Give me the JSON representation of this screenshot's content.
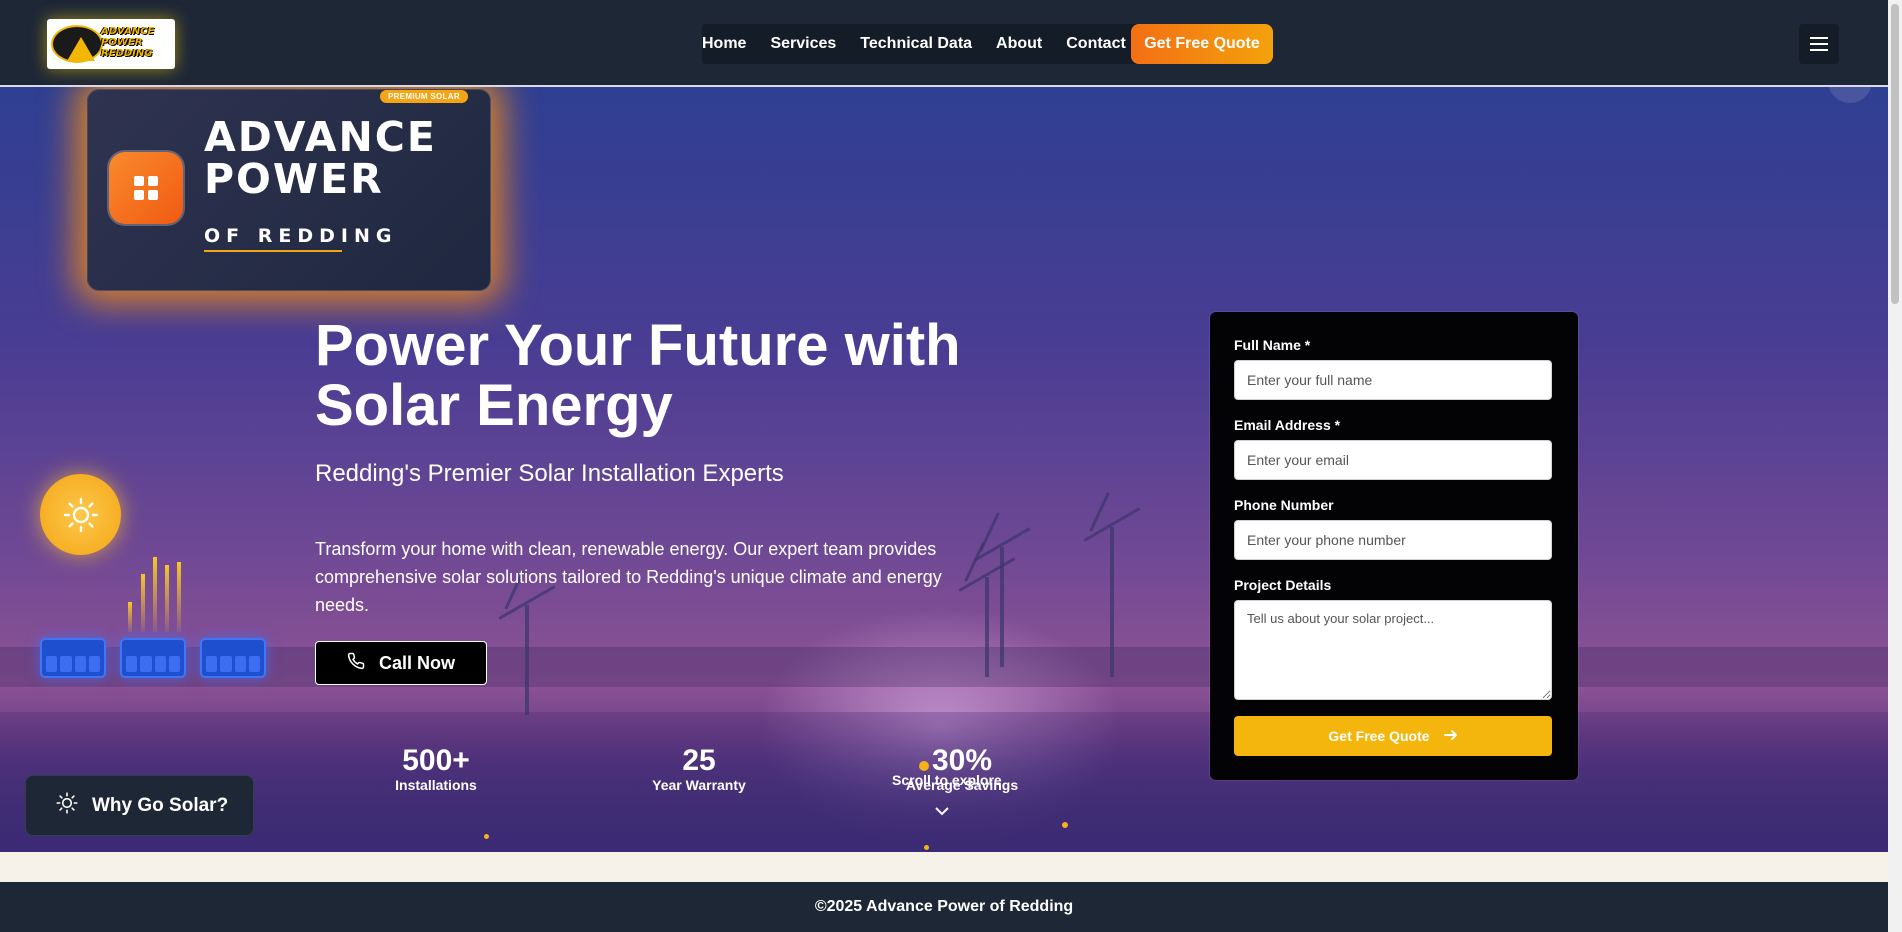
{
  "logo": {
    "text": "ADVANCE POWER REDDING"
  },
  "nav": {
    "links": [
      "Home",
      "Services",
      "Technical Data",
      "About",
      "Contact"
    ],
    "cta": "Get Free Quote"
  },
  "brand_card": {
    "badge": "PREMIUM SOLAR",
    "title_line1": "ADVANCE",
    "title_line2": "POWER",
    "subtitle": "OF REDDING"
  },
  "hero": {
    "title": "Power Your Future with Solar Energy",
    "subtitle": "Redding's Premier Solar Installation Experts",
    "description": "Transform your home with clean, renewable energy. Our expert team provides comprehensive solar solutions tailored to Redding's unique climate and energy needs.",
    "call_button": "Call Now",
    "scroll_hint": "Scroll to explore"
  },
  "stats": [
    {
      "value": "500+",
      "label": "Installations"
    },
    {
      "value": "25",
      "label": "Year Warranty"
    },
    {
      "value": "30%",
      "label": "Average Savings"
    }
  ],
  "why_button": "Why Go Solar?",
  "form": {
    "name_label": "Full Name *",
    "name_placeholder": "Enter your full name",
    "email_label": "Email Address *",
    "email_placeholder": "Enter your email",
    "phone_label": "Phone Number",
    "phone_placeholder": "Enter your phone number",
    "details_label": "Project Details",
    "details_placeholder": "Tell us about your solar project...",
    "submit": "Get Free Quote"
  },
  "footer": {
    "text": "©2025 Advance Power of Redding"
  },
  "colors": {
    "accent_orange": "#f36f14",
    "accent_yellow": "#f4b60c",
    "nav_bg": "#1e2736",
    "form_bg": "#030305"
  },
  "icons": [
    "menu-icon",
    "grid-icon",
    "sun-icon",
    "phone-icon",
    "arrow-right-icon",
    "chevron-down-icon"
  ]
}
